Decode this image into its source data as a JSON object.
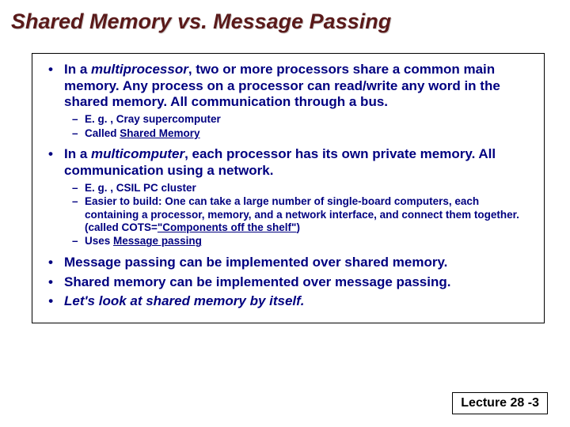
{
  "title": "Shared Memory vs. Message Passing",
  "bullets": {
    "b1_pre": "In a ",
    "b1_em": "multiprocessor",
    "b1_post": ", two or more processors share a common main memory. Any process on a processor can read/write any word in the shared memory. All communication through a bus.",
    "b1_sub1": "E. g. , Cray supercomputer",
    "b1_sub2_pre": "Called ",
    "b1_sub2_u": "Shared Memory",
    "b2_pre": "In a ",
    "b2_em": "multicomputer",
    "b2_post": ", each processor has its own private memory. All communication using a network.",
    "b2_sub1": "E. g. , CSIL PC cluster",
    "b2_sub2_pre": "Easier to build: One can take a large number of single-board computers, each containing a processor, memory, and a network interface, and connect them together. (called COTS=",
    "b2_sub2_u": "\"Components off the shelf\"",
    "b2_sub2_post": ")",
    "b2_sub3_pre": "Uses ",
    "b2_sub3_u": "Message passing",
    "b3": "Message passing can be implemented over shared memory.",
    "b4": "Shared memory can be implemented over message passing.",
    "b5": "Let's look at shared memory by itself."
  },
  "footer": "Lecture 28 -3"
}
